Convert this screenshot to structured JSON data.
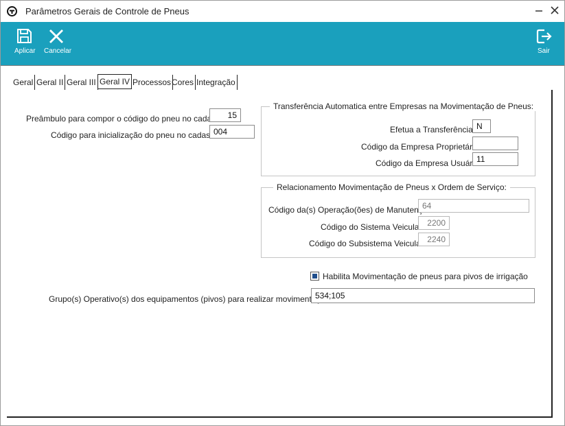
{
  "window": {
    "title": "Parâmetros Gerais de Controle de Pneus"
  },
  "toolbar": {
    "apply_label": "Aplicar",
    "cancel_label": "Cancelar",
    "exit_label": "Sair",
    "background_color": "#1aa0bd"
  },
  "tabs": [
    {
      "label": "Geral",
      "active": false
    },
    {
      "label": "Geral II",
      "active": false
    },
    {
      "label": "Geral III",
      "active": false
    },
    {
      "label": "Geral IV",
      "active": true
    },
    {
      "label": "Processos",
      "active": false
    },
    {
      "label": "Cores",
      "active": false
    },
    {
      "label": "Integração",
      "active": false
    }
  ],
  "form": {
    "preamble_label": "Preâmbulo para compor o código do pneu no cadastro:",
    "preamble_value": "15",
    "init_code_label": "Código para inicialização do pneu no cadastro:",
    "init_code_value": "004",
    "transfer_group": {
      "title": "Transferência Automatica entre Empresas na Movimentação de Pneus:",
      "execute_label": "Efetua a Transferência:",
      "execute_value": "N",
      "owner_label": "Código da Empresa Proprietária:",
      "owner_value": "",
      "user_label": "Código da Empresa Usuária:",
      "user_value": "11"
    },
    "relation_group": {
      "title": "Relacionamento Movimentação de Pneus x Ordem de Serviço:",
      "operation_label": "Código da(s) Operação(ões) de Manutenção:",
      "operation_value": "64",
      "system_label": "Código do Sistema Veicular:",
      "system_value": "2200",
      "subsystem_label": "Código do Subsistema Veicular:",
      "subsystem_value": "2240"
    },
    "pivot_checkbox_label": "Habilita Movimentação de pneus para pivos de irrigação",
    "pivot_checkbox_checked": true,
    "groups_label": "Grupo(s) Operativo(s) dos equipamentos (pivos) para realizar movimentação:",
    "groups_value": "534;105"
  }
}
